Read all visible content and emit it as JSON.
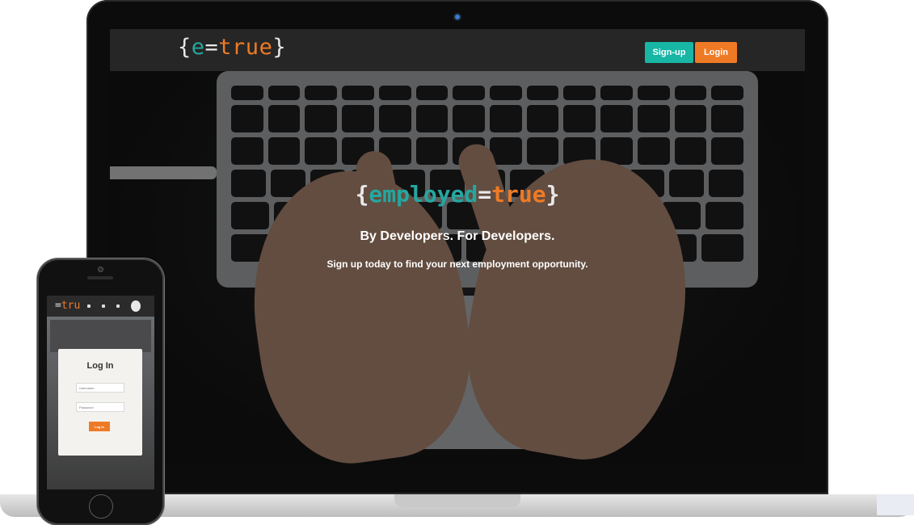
{
  "colors": {
    "teal": "#25a7a0",
    "orange": "#ef7a25",
    "signup_bg": "#18b6a5",
    "nav_bg": "#262626"
  },
  "desktop": {
    "logo": {
      "open": "{",
      "e": "e",
      "eq": "=",
      "true": "true",
      "close": "}"
    },
    "nav": {
      "signup_label": "Sign-up",
      "login_label": "Login"
    },
    "hero": {
      "title": {
        "open": "{",
        "employed": "employed",
        "eq": "=",
        "true": "true",
        "close": "}"
      },
      "subtitle": "By Developers. For Developers.",
      "description": "Sign up today to find your next employment opportunity."
    }
  },
  "mobile": {
    "logo": {
      "eq": "=",
      "tru": "tru"
    },
    "login": {
      "title": "Log In",
      "username_placeholder": "Username",
      "password_placeholder": "Password",
      "button_label": "Log In"
    }
  }
}
